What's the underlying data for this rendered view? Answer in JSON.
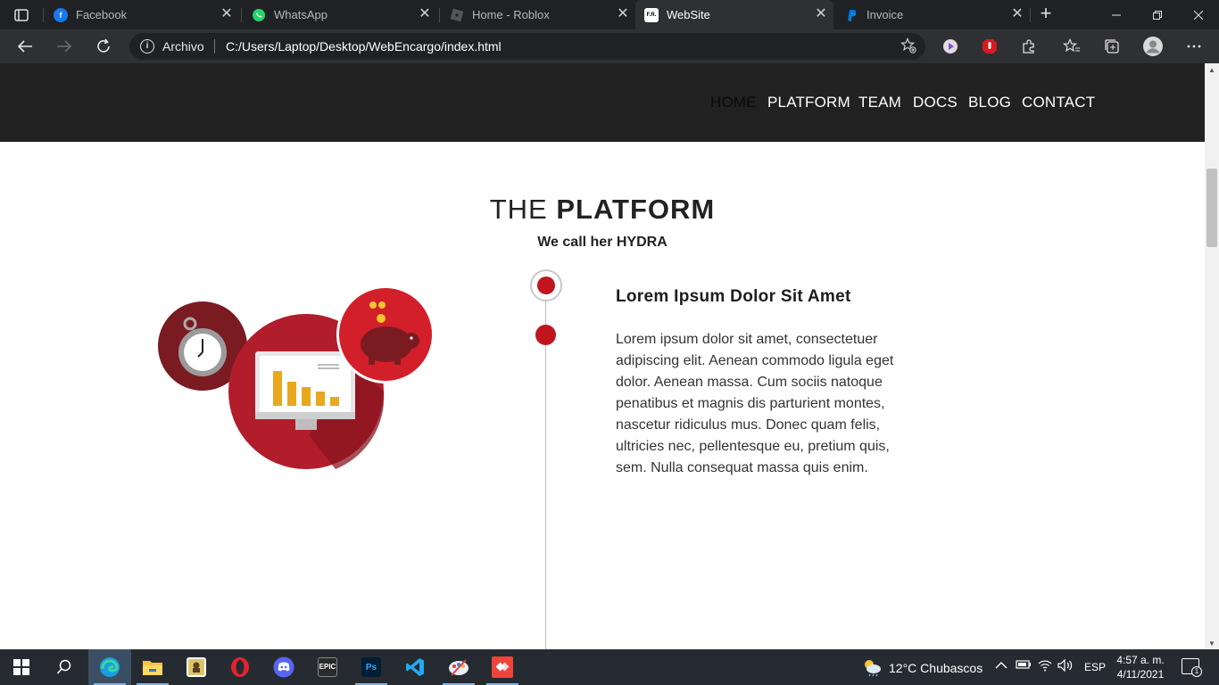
{
  "browser": {
    "tabs": [
      {
        "title": "Facebook",
        "icon": "facebook-icon"
      },
      {
        "title": "WhatsApp",
        "icon": "whatsapp-icon"
      },
      {
        "title": "Home - Roblox",
        "icon": "roblox-icon"
      },
      {
        "title": "WebSite",
        "icon": "website-icon",
        "active": true
      },
      {
        "title": "Invoice",
        "icon": "paypal-icon"
      }
    ],
    "site_favicon_text": "F.R.",
    "tab_close_glyph": "✕",
    "new_tab_glyph": "+",
    "address": {
      "label": "Archivo",
      "url": "C:/Users/Laptop/Desktop/WebEncargo/index.html"
    }
  },
  "site": {
    "nav": [
      "HOME",
      "PLATFORM",
      "TEAM",
      "DOCS",
      "BLOG",
      "CONTACT"
    ],
    "current_nav": "HOME",
    "section": {
      "title_light": "THE",
      "title_bold": "PLATFORM",
      "subtitle": "We call her HYDRA"
    },
    "feature": {
      "heading": "Lorem Ipsum Dolor Sit Amet",
      "body": "Lorem ipsum dolor sit amet, consectetuer adipiscing elit. Aenean commodo ligula eget dolor. Aenean massa. Cum sociis natoque penatibus et magnis dis parturient montes, nascetur ridiculus mus. Donec quam felis, ultricies nec, pellentesque eu, pretium quis, sem. Nulla consequat massa quis enim."
    },
    "accent_color": "#c0151d"
  },
  "taskbar": {
    "weather": "12°C  Chubascos",
    "language": "ESP",
    "time": "4:57 a. m.",
    "date": "4/11/2021",
    "notification_count": "1",
    "apps": [
      "windows-start",
      "search",
      "edge",
      "file-explorer",
      "game-app",
      "opera",
      "discord",
      "epic-games",
      "photoshop",
      "vscode",
      "paint-app",
      "anydesk"
    ],
    "epic_label": "EPIC",
    "ps_label": "Ps"
  }
}
